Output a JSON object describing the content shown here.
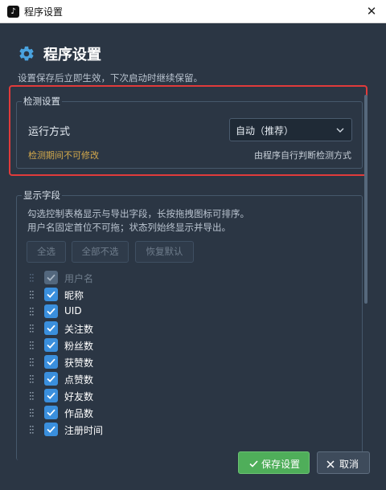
{
  "window": {
    "title": "程序设置",
    "icon": "tiktok-logo-icon",
    "close_icon": "close-icon"
  },
  "header": {
    "title": "程序设置",
    "icon": "gear-icon",
    "subtitle": "设置保存后立即生效，下次启动时继续保留。"
  },
  "detect": {
    "legend": "检测设置",
    "run_mode_label": "运行方式",
    "run_mode_value": "自动（推荐）",
    "locked_note": "检测期间不可修改",
    "hint": "由程序自行判断检测方式"
  },
  "fields": {
    "legend": "显示字段",
    "desc_line1": "勾选控制表格显示与导出字段，长按拖拽图标可排序。",
    "desc_line2": "用户名固定首位不可拖；状态列始终显示并导出。",
    "buttons": {
      "select_all": "全选",
      "select_none": "全部不选",
      "restore_default": "恢复默认"
    },
    "items": [
      {
        "label": "用户名",
        "checked": true,
        "disabled": true
      },
      {
        "label": "昵称",
        "checked": true,
        "disabled": false
      },
      {
        "label": "UID",
        "checked": true,
        "disabled": false
      },
      {
        "label": "关注数",
        "checked": true,
        "disabled": false
      },
      {
        "label": "粉丝数",
        "checked": true,
        "disabled": false
      },
      {
        "label": "获赞数",
        "checked": true,
        "disabled": false
      },
      {
        "label": "点赞数",
        "checked": true,
        "disabled": false
      },
      {
        "label": "好友数",
        "checked": true,
        "disabled": false
      },
      {
        "label": "作品数",
        "checked": true,
        "disabled": false
      },
      {
        "label": "注册时间",
        "checked": true,
        "disabled": false
      }
    ]
  },
  "footer": {
    "save_label": "保存设置",
    "cancel_label": "取消"
  },
  "colors": {
    "accent": "#3a8fdd",
    "save": "#4fae5a",
    "highlight": "#e13b3b",
    "background": "#2b3644"
  }
}
